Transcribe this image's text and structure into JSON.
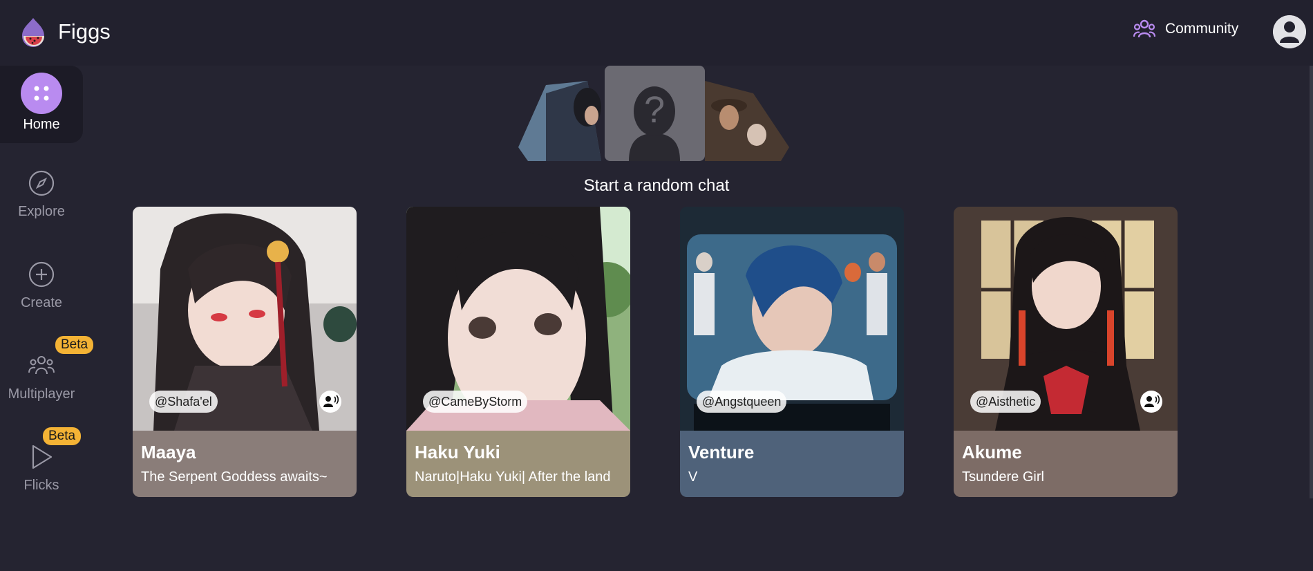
{
  "app": {
    "title": "Figgs"
  },
  "header": {
    "community_label": "Community"
  },
  "sidebar": {
    "items": [
      {
        "label": "Home",
        "icon": "apps-icon",
        "active": true
      },
      {
        "label": "Explore",
        "icon": "compass-icon",
        "active": false
      },
      {
        "label": "Create",
        "icon": "plus-circle-icon",
        "active": false
      },
      {
        "label": "Multiplayer",
        "icon": "users-icon",
        "active": false,
        "badge": "Beta"
      },
      {
        "label": "Flicks",
        "icon": "play-icon",
        "active": false,
        "badge": "Beta"
      }
    ]
  },
  "random_chat": {
    "label": "Start a random chat"
  },
  "cards": [
    {
      "name": "Maaya",
      "description": "The Serpent Goddess awaits~",
      "creator": "@Shafa'el",
      "voice": true,
      "info_color": "#8a7d79"
    },
    {
      "name": "Haku Yuki",
      "description": "Naruto|Haku Yuki| After the land",
      "creator": "@CameByStorm",
      "voice": false,
      "info_color": "#9c9279"
    },
    {
      "name": "Venture",
      "description": "V",
      "creator": "@Angstqueen",
      "voice": false,
      "info_color": "#4f627a"
    },
    {
      "name": "Akume",
      "description": "Tsundere Girl",
      "creator": "@Aisthetic",
      "voice": true,
      "info_color": "#7d6c66"
    }
  ],
  "colors": {
    "background": "#252431",
    "topbar": "#22212e",
    "accent": "#b98bf0",
    "beta_badge": "#f4b335"
  }
}
